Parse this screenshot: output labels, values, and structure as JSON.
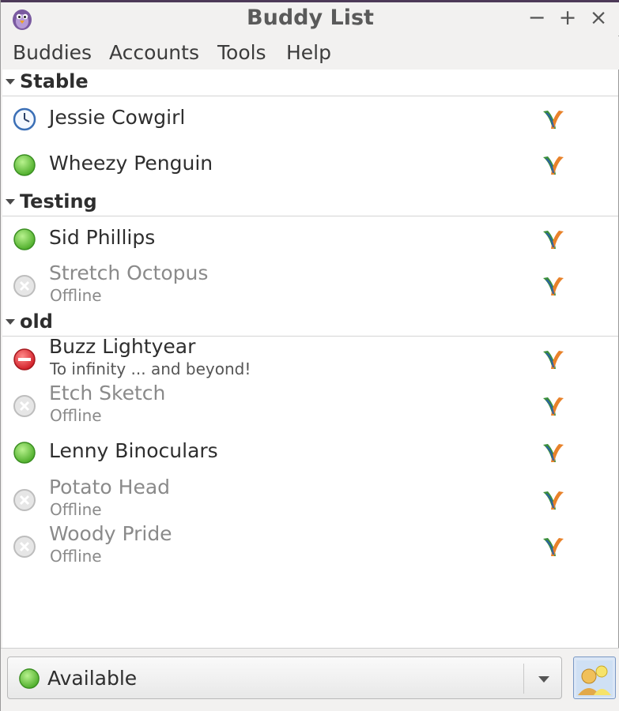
{
  "window": {
    "title": "Buddy List",
    "controls": [
      "minimize",
      "maximize",
      "close"
    ]
  },
  "menu": [
    "Buddies",
    "Accounts",
    "Tools",
    "Help"
  ],
  "groups": [
    {
      "name": "Stable",
      "buddies": [
        {
          "name": "Jessie Cowgirl",
          "status": "idle",
          "status_icon": "clock-icon",
          "protocol_icon": "xmpp-icon"
        },
        {
          "name": "Wheezy Penguin",
          "status": "available",
          "status_icon": "available-icon",
          "protocol_icon": "xmpp-icon"
        }
      ]
    },
    {
      "name": "Testing",
      "buddies": [
        {
          "name": "Sid Phillips",
          "status": "available",
          "status_icon": "available-icon",
          "protocol_icon": "xmpp-icon"
        },
        {
          "name": "Stretch Octopus",
          "message": "Offline",
          "status": "offline",
          "status_icon": "offline-icon",
          "protocol_icon": "xmpp-icon"
        }
      ]
    },
    {
      "name": "old",
      "buddies": [
        {
          "name": "Buzz Lightyear",
          "message": "To infinity ... and beyond!",
          "status": "busy",
          "status_icon": "do-not-disturb-icon",
          "protocol_icon": "xmpp-icon"
        },
        {
          "name": "Etch Sketch",
          "message": "Offline",
          "status": "offline",
          "status_icon": "offline-icon",
          "protocol_icon": "xmpp-icon"
        },
        {
          "name": "Lenny Binoculars",
          "status": "available",
          "status_icon": "available-icon",
          "protocol_icon": "xmpp-icon"
        },
        {
          "name": "Potato Head",
          "message": "Offline",
          "status": "offline",
          "status_icon": "offline-icon",
          "protocol_icon": "xmpp-icon"
        },
        {
          "name": "Woody Pride",
          "message": "Offline",
          "status": "offline",
          "status_icon": "offline-icon",
          "protocol_icon": "xmpp-icon"
        }
      ]
    }
  ],
  "status_selector": {
    "label": "Available",
    "icon": "available-icon"
  },
  "colors": {
    "available": "#5cc03a",
    "busy": "#d7272f",
    "offline": "#c4c4c4",
    "idle": "#3b6fb6",
    "title_rule": "#4d3a58"
  }
}
